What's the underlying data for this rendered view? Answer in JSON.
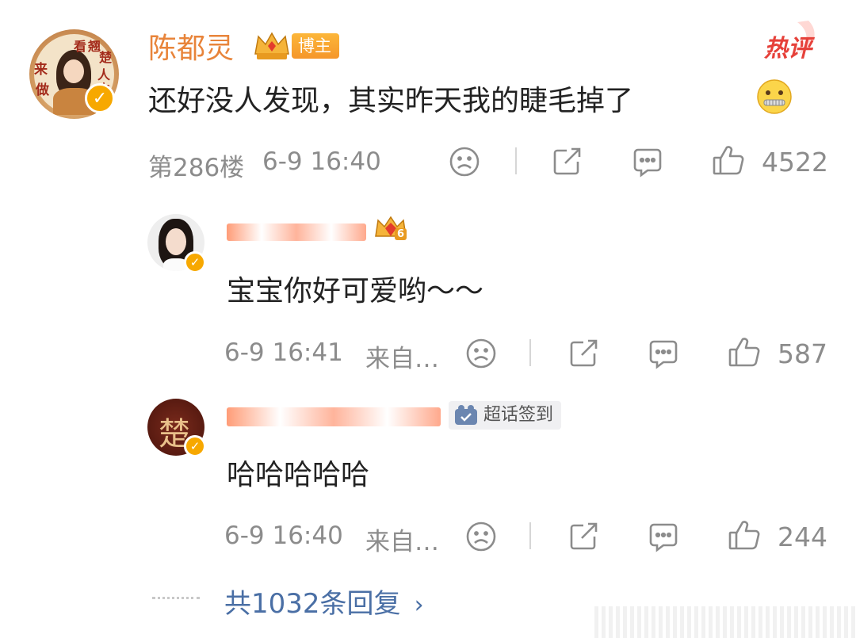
{
  "main_comment": {
    "username": "陈都灵",
    "badge": "博主",
    "hot_tag": "热评",
    "text": "还好没人发现，其实昨天我的睫毛掉了",
    "emoji": "zipper-mouth-face",
    "floor": "第286楼",
    "time": "6-9 16:40",
    "likes": "4522",
    "avatar_text": [
      "来",
      "看",
      "翘",
      "楚",
      "做",
      "人",
      "中"
    ]
  },
  "replies": [
    {
      "username": "",
      "text": "宝宝你好可爱哟～～",
      "time": "6-9 16:41",
      "source": "来自…",
      "likes": "587",
      "crown_level": "6"
    },
    {
      "username": "",
      "tag": "超话签到",
      "text": "哈哈哈哈哈",
      "time": "6-9 16:40",
      "source": "来自…",
      "likes": "244",
      "avatar_text": "楚"
    }
  ],
  "more_replies": "共1032条回复",
  "colors": {
    "accent": "#e8843a",
    "hot": "#e6413a",
    "meta": "#8c8c8c",
    "verified": "#f7a800"
  }
}
